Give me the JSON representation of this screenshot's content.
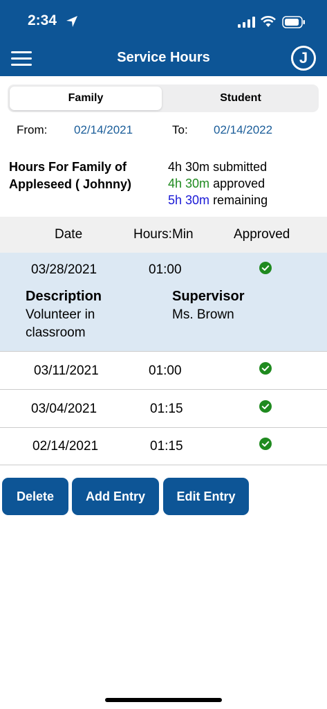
{
  "status_bar": {
    "time": "2:34"
  },
  "nav": {
    "title": "Service Hours",
    "avatar_letter": "J"
  },
  "segment": {
    "family": "Family",
    "student": "Student"
  },
  "range": {
    "from_label": "From:",
    "from_value": "02/14/2021",
    "to_label": "To:",
    "to_value": "02/14/2022"
  },
  "summary": {
    "title_line1": "Hours For Family of",
    "title_line2": "Appleseed ( Johnny)",
    "submitted_value": "4h 30m",
    "submitted_label": "submitted",
    "approved_value": "4h 30m",
    "approved_label": "approved",
    "remaining_value": "5h 30m",
    "remaining_label": "remaining"
  },
  "table": {
    "headers": {
      "date": "Date",
      "hours": "Hours:Min",
      "approved": "Approved"
    },
    "rows": [
      {
        "date": "03/28/2021",
        "hours": "01:00",
        "approved": true
      },
      {
        "date": "03/11/2021",
        "hours": "01:00",
        "approved": true
      },
      {
        "date": "03/04/2021",
        "hours": "01:15",
        "approved": true
      },
      {
        "date": "02/14/2021",
        "hours": "01:15",
        "approved": true
      }
    ],
    "selected_detail": {
      "description_label": "Description",
      "description_line1": "Volunteer in",
      "description_line2": "classroom",
      "supervisor_label": "Supervisor",
      "supervisor_value": "Ms. Brown"
    }
  },
  "actions": {
    "delete": "Delete",
    "add": "Add Entry",
    "edit": "Edit Entry"
  },
  "colors": {
    "brand": "#0d5596",
    "approved_green": "#1f8a1f",
    "remaining_blue": "#1a19d6",
    "selected_row": "#dce8f3"
  },
  "icons": [
    "location-arrow-icon",
    "signal-icon",
    "wifi-icon",
    "battery-icon",
    "menu-icon",
    "check-circle-icon"
  ]
}
